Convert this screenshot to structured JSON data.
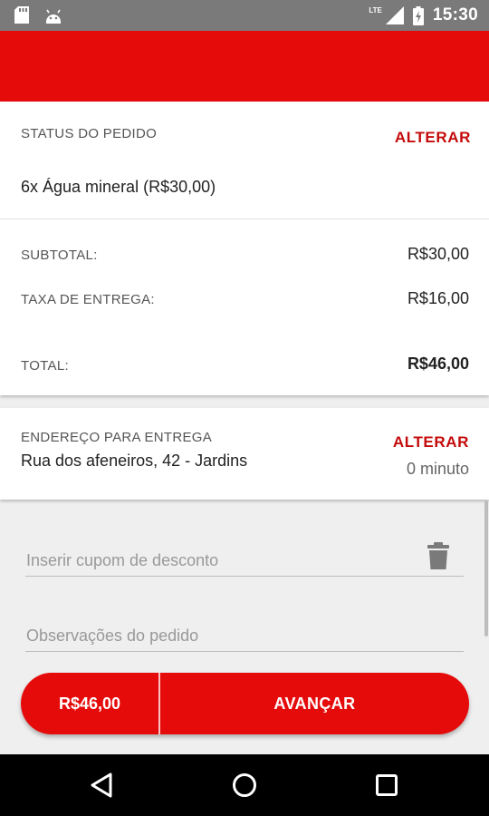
{
  "status_bar": {
    "network": "LTE",
    "time": "15:30",
    "icons": [
      "sd-card-icon",
      "android-icon",
      "signal-icon",
      "battery-icon"
    ]
  },
  "colors": {
    "accent": "#e60b0b",
    "link": "#c40b0b",
    "status_bar": "#7a7a7a"
  },
  "order": {
    "status_label": "STATUS DO PEDIDO",
    "change_label": "ALTERAR",
    "item": "6x Água mineral (R$30,00)",
    "subtotal_label": "SUBTOTAL:",
    "subtotal_value": "R$30,00",
    "fee_label": "TAXA DE ENTREGA:",
    "fee_value": "R$16,00",
    "total_label": "TOTAL:",
    "total_value": "R$46,00"
  },
  "delivery": {
    "address_label": "ENDEREÇO PARA ENTREGA",
    "address": "Rua dos afeneiros, 42 - Jardins",
    "change_label": "ALTERAR",
    "time": "0 minuto"
  },
  "form": {
    "coupon_placeholder": "Inserir cupom de desconto",
    "notes_placeholder": "Observações do pedido"
  },
  "checkout": {
    "price": "R$46,00",
    "button_label": "AVANÇAR"
  }
}
